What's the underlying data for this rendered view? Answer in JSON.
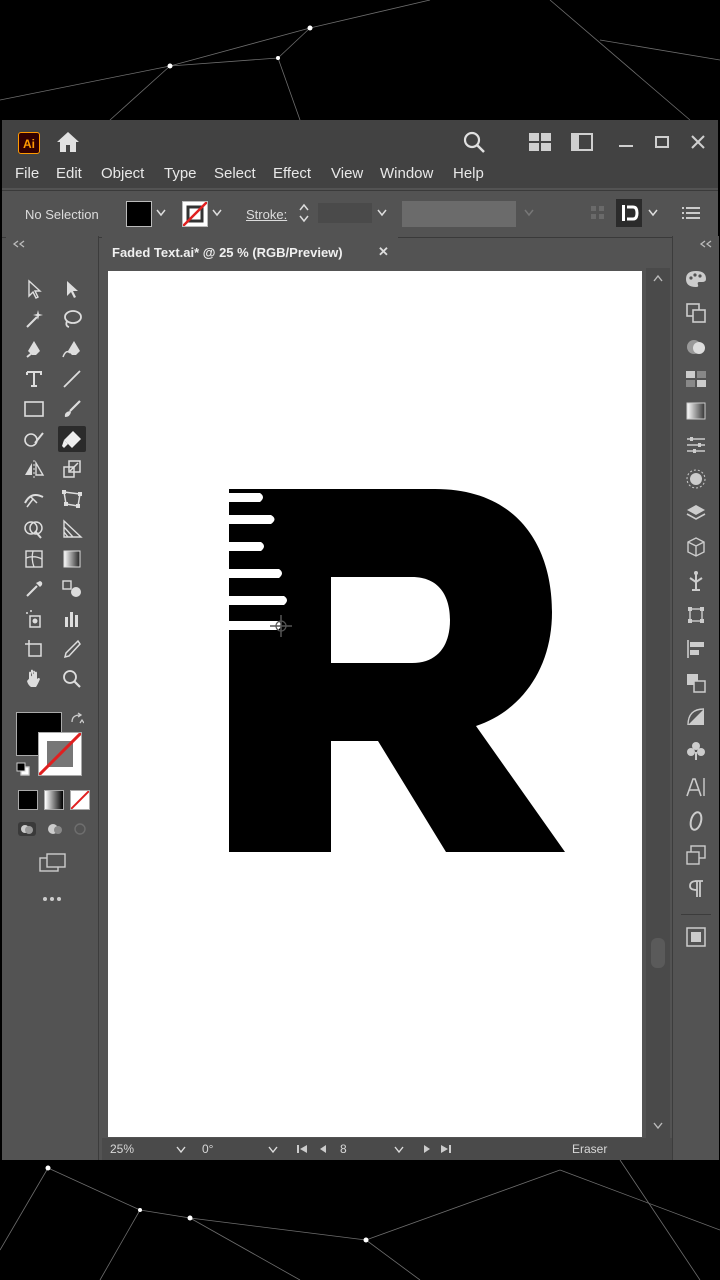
{
  "app": {
    "logo": "Ai",
    "menu": [
      "File",
      "Edit",
      "Object",
      "Type",
      "Select",
      "Effect",
      "View",
      "Window",
      "Help"
    ]
  },
  "control_bar": {
    "selection_label": "No Selection",
    "stroke_label": "Stroke:"
  },
  "document": {
    "tab_title": "Faded Text.ai* @ 25 % (RGB/Preview)",
    "close_glyph": "✕",
    "artwork_letter": "R"
  },
  "status_bar": {
    "zoom": "25%",
    "rotation": "0°",
    "artboard_number": "8",
    "active_tool": "Eraser"
  },
  "colors": {
    "fill": "#000000",
    "stroke": "none",
    "accent": "#ff9a00"
  },
  "tools": [
    "selection-tool",
    "direct-selection-tool",
    "magic-wand-tool",
    "lasso-tool",
    "pen-tool",
    "curvature-tool",
    "type-tool",
    "line-tool",
    "rectangle-tool",
    "paintbrush-tool",
    "shaper-tool",
    "eraser-tool",
    "reflect-tool",
    "scale-tool",
    "width-tool",
    "free-transform-tool",
    "shape-builder-tool",
    "perspective-grid-tool",
    "mesh-tool",
    "gradient-tool",
    "eyedropper-tool",
    "blend-tool",
    "symbol-sprayer-tool",
    "column-graph-tool",
    "artboard-tool",
    "slice-tool",
    "hand-tool",
    "zoom-tool"
  ],
  "active_tool_icon": "eraser-tool"
}
